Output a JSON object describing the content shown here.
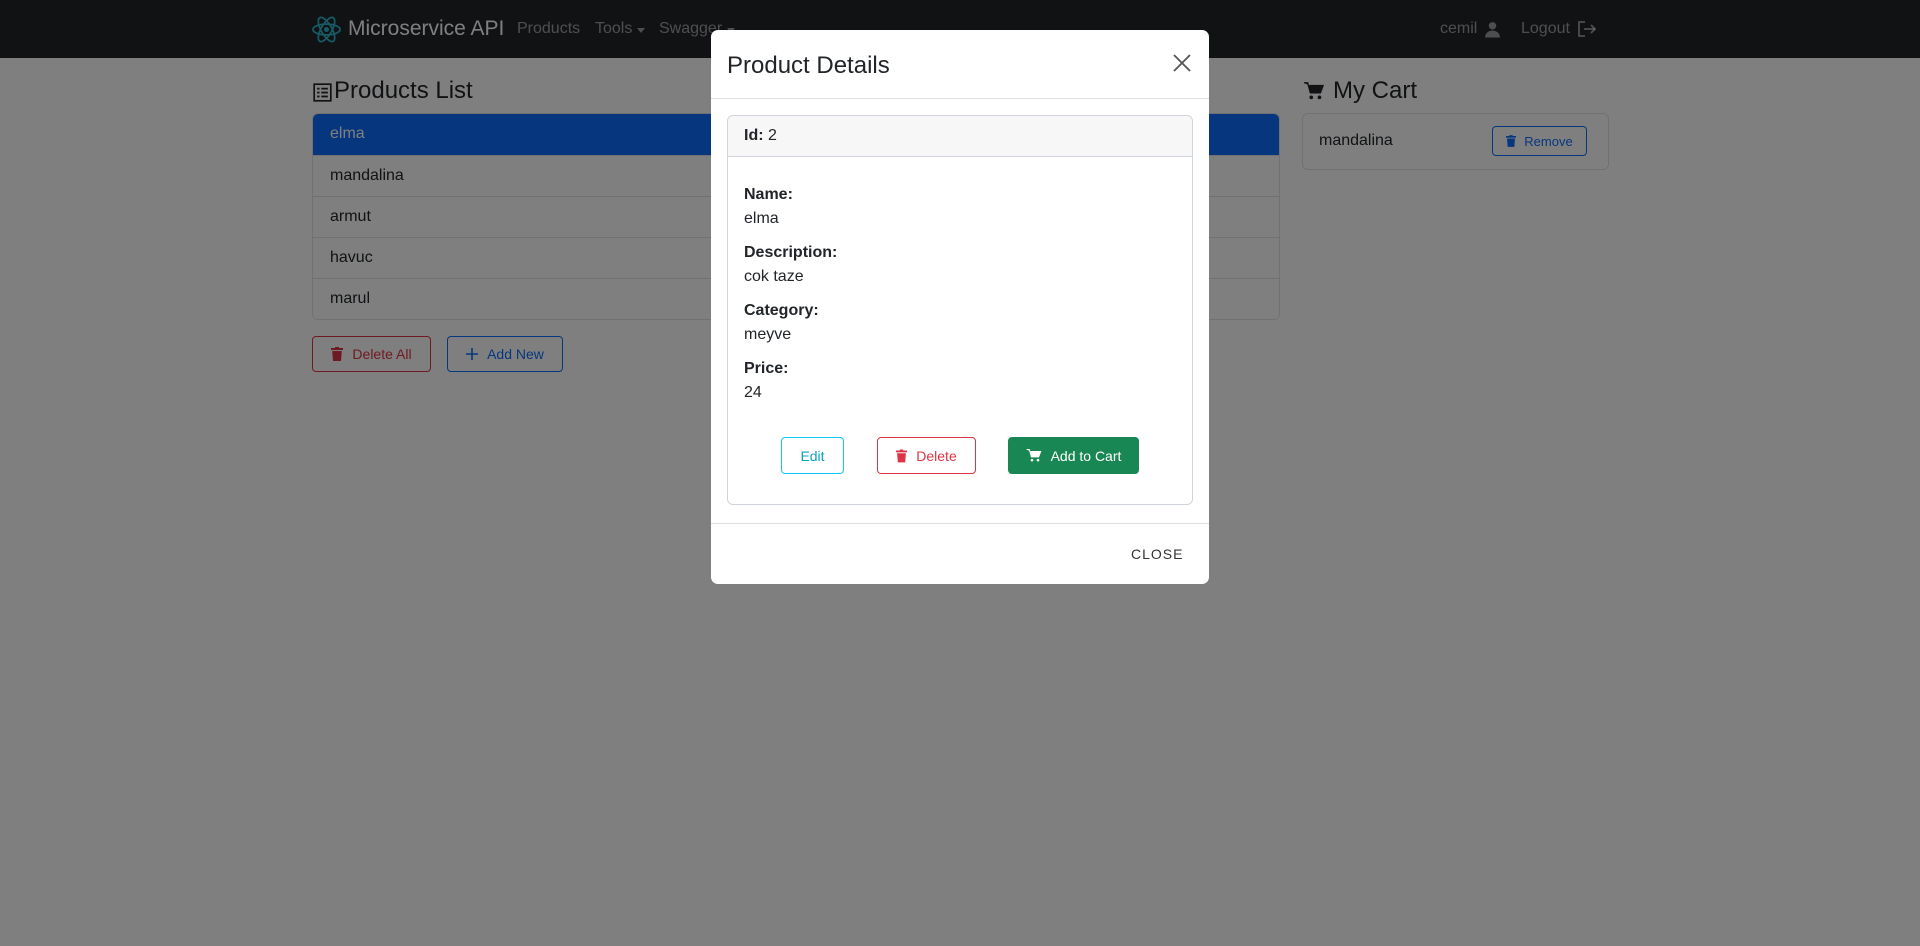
{
  "navbar": {
    "brand": "Microservice API",
    "links": [
      "Products",
      "Tools",
      "Swagger"
    ],
    "user": "cemil",
    "logout": "Logout"
  },
  "products": {
    "title": "Products List",
    "items": [
      "elma",
      "mandalina",
      "armut",
      "havuc",
      "marul"
    ],
    "delete_all": "Delete All",
    "add_new": "Add New"
  },
  "cart": {
    "title": "My Cart",
    "items": [
      {
        "name": "mandalina",
        "action": "Remove"
      }
    ]
  },
  "modal": {
    "title": "Product Details",
    "id_label": "Id:",
    "id_value": "2",
    "name_label": "Name:",
    "name_value": "elma",
    "description_label": "Description:",
    "description_value": "cok taze",
    "category_label": "Category:",
    "category_value": "meyve",
    "price_label": "Price:",
    "price_value": "24",
    "edit": "Edit",
    "delete": "Delete",
    "add_to_cart": "Add to Cart",
    "close": "CLOSE"
  },
  "colors": {
    "navbar": "#212529",
    "active_item": "#0d6efd",
    "danger": "#dc3545",
    "success": "#198754",
    "info": "#0dcaf0"
  }
}
